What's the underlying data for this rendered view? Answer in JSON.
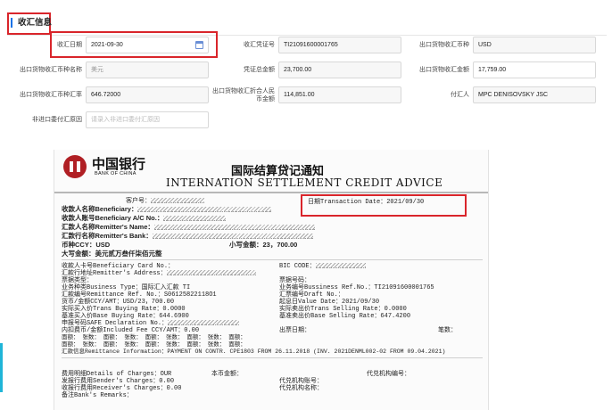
{
  "section": {
    "title": "收汇信息"
  },
  "form": {
    "receipt_date_label": "收汇日期",
    "receipt_date_value": "2021-09-30",
    "voucher_no_label": "收汇凭证号",
    "voucher_no_value": "TI21091600001765",
    "currency_label": "出口货物收汇币种",
    "currency_value": "USD",
    "currency_name_label": "出口货物收汇币种名称",
    "currency_name_value": "美元",
    "voucher_total_label": "凭证总金额",
    "voucher_total_value": "23,700.00",
    "export_amount_label": "出口货物收汇金额",
    "export_amount_value": "17,759.00",
    "rate_label": "出口货物收汇币种汇率",
    "rate_value": "646.72000",
    "rmb_amount_label": "出口货物收汇折合人民币金额",
    "rmb_amount_value": "114,851.00",
    "payer_label": "付汇人",
    "payer_value": "MPC DENISOVSKY JSC",
    "non_remit_reason_label": "非进口委付汇原因",
    "non_remit_reason_placeholder": "请录入非进口委付汇原因"
  },
  "doc": {
    "bank_cn": "中国银行",
    "bank_en": "BANK OF CHINA",
    "title_cn": "国际结算贷记通知",
    "title_en": "INTERNATION SETTLEMENT CREDIT ADVICE",
    "customer_no": "客户号：",
    "tx_date": "日期Transaction Date：2021/09/30",
    "beneficiary": "收款人名称Beneficiary：",
    "beneficiary_ac": "收款人账号Beneficiary A/C No.：",
    "remitter_name": "汇款人名称Remitter's Name：",
    "remitter_bank": "汇款行名称Remitter's Bank：",
    "ccy": "币种CCY：USD",
    "amount_upper": "小写金额：23，700.00",
    "amount_words": "大写金额：美元贰万叁仟柒佰元整",
    "card_no": "收款人卡号Beneficiary Card No.：",
    "bic": "BIC CODE：",
    "remitter_addr": "汇款行地址Remitter's Address：",
    "bill_type": "票据类型：",
    "bill_no": "票据号码：",
    "biz_type": "业务种类Business Type：国际汇入汇款 TI",
    "biz_no": "业务编号Bussiness Ref.No.：TI21091600001765",
    "remit_ref": "汇款编号Remittance Ref. No.：S06125822118O1",
    "draft_no": "汇票编号Draft No.：",
    "ccy_amt": "货币/金额CCY/AMT：USD/23，700.00",
    "value_date": "起息日Value Date：2021/09/30",
    "buy_rate": "实际买入价Trans Buying Rate：0.0000",
    "sell_rate": "实际卖出价Trans Selling Rate：0.0000",
    "base_buy": "基准买入价Base Buying Rate：644.6900",
    "base_sell": "基准卖出价Base Selling Rate：647.4200",
    "safe_no": "申报号码SAFE Declaration No.：",
    "fee": "内扣费币/金额Included Fee CCY/AMT：0.00",
    "out_date": "出票日期：",
    "pen_count": "笔数：",
    "row_a": "面额：      张数：      面额：      张数：      面额：      张数：      面额：      张数：      面额：",
    "row_b": "面额：      张数：      面额：      张数：      面额：      张数：      面额：      张数：      面额：",
    "remit_info": "汇款信息Remittance Information：PAYMENT ON CONTR. CPE1803 FROM 26.11.2018 (INV.  2021DENML002-02 FROM 09.04.2021)",
    "charges": "费用明细Details of Charges：OUR",
    "local_amt": "本币金额：",
    "agent_no": "代兑机构编号：",
    "sender_charges": "发报行费用Sender's Charges：0.00",
    "agent_acct": "代兑机构账号：",
    "receiver_charges": "收报行费用Receiver's Charges：0.00",
    "agent_name": "代兑机构名称：",
    "remarks": "备注Bank's Remarks："
  }
}
